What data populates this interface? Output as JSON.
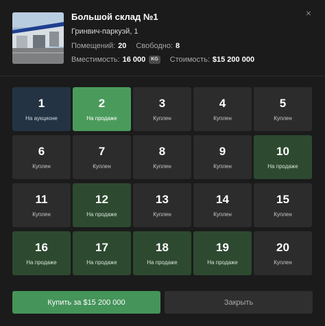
{
  "warehouse": {
    "title": "Большой склад №1",
    "address": "Гринвич-паркуэй, 1",
    "rooms_label": "Помещений:",
    "rooms_value": "20",
    "free_label": "Свободно:",
    "free_value": "8",
    "capacity_label": "Вместимость:",
    "capacity_value": "16 000",
    "capacity_unit": "KG",
    "price_label": "Стоимость:",
    "price_value": "$15 200 000"
  },
  "close_icon": "×",
  "units": [
    {
      "number": "1",
      "status": "На аукционе",
      "state": "auction"
    },
    {
      "number": "2",
      "status": "На продаже",
      "state": "selected"
    },
    {
      "number": "3",
      "status": "Куплен",
      "state": "bought"
    },
    {
      "number": "4",
      "status": "Куплен",
      "state": "bought"
    },
    {
      "number": "5",
      "status": "Куплен",
      "state": "bought"
    },
    {
      "number": "6",
      "status": "Куплен",
      "state": "bought"
    },
    {
      "number": "7",
      "status": "Куплен",
      "state": "bought"
    },
    {
      "number": "8",
      "status": "Куплен",
      "state": "bought"
    },
    {
      "number": "9",
      "status": "Куплен",
      "state": "bought"
    },
    {
      "number": "10",
      "status": "На продаже",
      "state": "sale"
    },
    {
      "number": "11",
      "status": "Куплен",
      "state": "bought"
    },
    {
      "number": "12",
      "status": "На продаже",
      "state": "sale"
    },
    {
      "number": "13",
      "status": "Куплен",
      "state": "bought"
    },
    {
      "number": "14",
      "status": "Куплен",
      "state": "bought"
    },
    {
      "number": "15",
      "status": "Куплен",
      "state": "bought"
    },
    {
      "number": "16",
      "status": "На продаже",
      "state": "sale"
    },
    {
      "number": "17",
      "status": "На продаже",
      "state": "sale"
    },
    {
      "number": "18",
      "status": "На продаже",
      "state": "sale"
    },
    {
      "number": "19",
      "status": "На продаже",
      "state": "sale"
    },
    {
      "number": "20",
      "status": "Куплен",
      "state": "bought"
    }
  ],
  "buttons": {
    "buy": "Купить за $15 200 000",
    "close": "Закрыть"
  }
}
